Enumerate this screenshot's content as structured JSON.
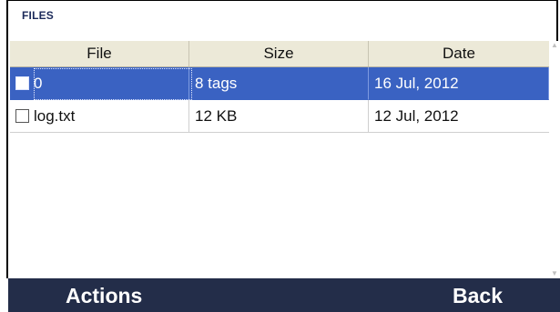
{
  "window": {
    "title": "FILES"
  },
  "table": {
    "columns": [
      "File",
      "Size",
      "Date"
    ],
    "rows": [
      {
        "file": "0",
        "size": "8 tags",
        "date": "16 Jul, 2012",
        "selected": true,
        "checked": false
      },
      {
        "file": "log.txt",
        "size": "12 KB",
        "date": "12 Jul, 2012",
        "selected": false,
        "checked": false
      }
    ]
  },
  "softkeys": {
    "left_label": "Actions",
    "right_label": "Back"
  },
  "colors": {
    "selection": "#3a62c2",
    "bottom_bar": "#232d49",
    "header_bg": "#ece9d8",
    "title_text": "#1b2a5a"
  },
  "icons": {
    "scroll_up": "scroll-up-arrow-icon",
    "scroll_down": "scroll-down-arrow-icon",
    "checkbox": "checkbox-icon"
  }
}
